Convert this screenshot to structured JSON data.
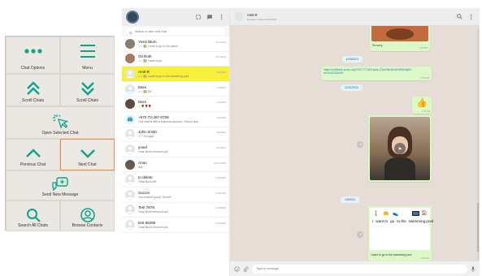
{
  "panel": {
    "buttons": [
      {
        "label": "Chat Options",
        "icon": "more-dots-icon"
      },
      {
        "label": "Menu",
        "icon": "menu-icon"
      },
      {
        "label": "Scroll Chats",
        "icon": "double-chevron-up-icon"
      },
      {
        "label": "Scroll Chats",
        "icon": "double-chevron-down-icon"
      },
      {
        "label": "Open Selected Chat",
        "icon": "cursor-click-icon"
      },
      {
        "label": "Previous Chat",
        "icon": "chevron-up-icon"
      },
      {
        "label": "Next Chat",
        "icon": "chevron-down-icon"
      },
      {
        "label": "Send New Message",
        "icon": "message-compose-icon"
      },
      {
        "label": "Search All Chats",
        "icon": "search-icon"
      },
      {
        "label": "Browse Contacts",
        "icon": "contact-icon"
      }
    ],
    "selected_index": 6,
    "accent": "#0aa58b",
    "highlight": "#f0883e"
  },
  "sidebar": {
    "search_placeholder": "Search or start new chat",
    "chats": [
      {
        "name": "Yossi Blum",
        "date": "Thursday",
        "msg": "✓✓ 🖼️ I want to go to the planet",
        "avatar": "photo1"
      },
      {
        "name": "Gil Roth",
        "date": "Thursday",
        "msg": "✓✓ 🖼️ I want to go",
        "avatar": "photo2"
      },
      {
        "name": "Amit R",
        "date": "1/6/2022",
        "msg": "✓✓ 🖼️ I want to go to the swimming pool",
        "avatar": "default",
        "active": true
      },
      {
        "name": "Mum",
        "date": "1/3/2022",
        "msg": "✓✓ 🖼️ Gif",
        "avatar": "default"
      },
      {
        "name": "Mom",
        "date": "1/3/2022",
        "msg": "✓ 🌹🌹🌹",
        "avatar": "photo3"
      },
      {
        "name": "+972 73-367-0706",
        "date": "1/3/2022",
        "msg": "This chat is with a business account. Click to lear...",
        "avatar": "biz"
      },
      {
        "name": "John Smith",
        "date": "8/4/2021",
        "msg": "✓✓ Ech gad",
        "avatar": "default"
      },
      {
        "name": "yosef",
        "date": "8/7/2021",
        "msg": "Yossi Blum removed you",
        "avatar": "default"
      },
      {
        "name": "Anan",
        "date": "12/22/2020",
        "msg": "test",
        "avatar": "photo4"
      },
      {
        "name": "to delete",
        "date": "11/9/2020",
        "msg": "Yossi Blum left",
        "avatar": "default"
      },
      {
        "name": "Soccer",
        "date": "11/9/2020",
        "msg": "You created group \"Soccer\"",
        "avatar": "default"
      },
      {
        "name": "Test 7878",
        "date": "11/9/2020",
        "msg": "Yossi Blum removed you",
        "avatar": "default"
      },
      {
        "name": "test 65465",
        "date": "11/9/2020",
        "msg": "Yossi Blum removed you",
        "avatar": "default"
      }
    ]
  },
  "conversation": {
    "contact_name": "Amit R",
    "status": "last seen today at 6:31 PM",
    "top_caption": "So sorry",
    "top_time": "7:10 PM",
    "date1": "6/18/2021",
    "link_text": "https://us05web.zoom.us/j/7907777784?pwd=TTcvRkh4b3dFdE8VNjdNeUVoZDZ0Zz09",
    "link_time": "9:57 PM",
    "date2": "12/21/2021",
    "thumb_time": "7:25 AM",
    "date3": "1/6/2022",
    "symbol_words": [
      "I",
      "want to",
      "go",
      "to the",
      "swimming pool"
    ],
    "symbol_caption": "I want to go to the swimming pool",
    "symbol_time": "7:09 AM",
    "compose_placeholder": "Type a message"
  }
}
